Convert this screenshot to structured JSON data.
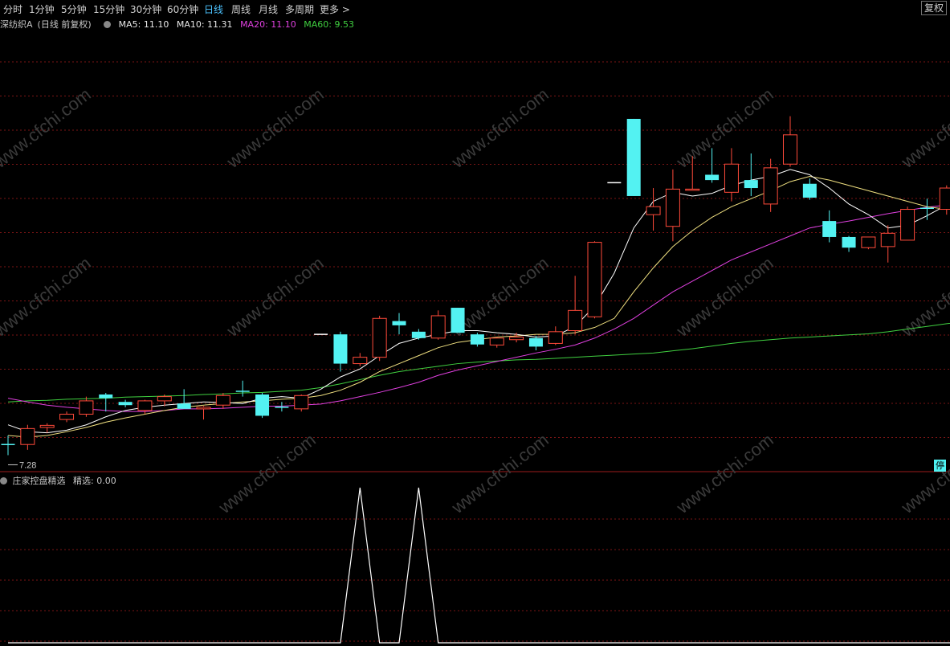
{
  "toolbar": {
    "tabs": [
      "分时",
      "1分钟",
      "5分钟",
      "15分钟",
      "30分钟",
      "60分钟",
      "日线",
      "周线",
      "月线",
      "多周期",
      "更多 >"
    ],
    "active_tab": "日线",
    "adjust_button": "复权"
  },
  "info": {
    "stock": "深纺织A",
    "period": "(日线 前复权)",
    "ma5": "MA5: 11.10",
    "ma10": "MA10: 11.31",
    "ma20": "MA20: 11.10",
    "ma60": "MA60: 9.53"
  },
  "indicator": {
    "name": "庄家控盘精选",
    "value": "精选: 0.00"
  },
  "low_marker": "7.28",
  "stop_badge": "停",
  "watermark": "www.cfchi.com",
  "colors": {
    "up": "#ff4a3a",
    "down": "#53f2f2",
    "ma5": "#ffffff",
    "ma10": "#f0e080",
    "ma20": "#e040e0",
    "ma60": "#40d040",
    "grid": "#7a1515",
    "indicator_line": "#ffffff"
  },
  "chart_data": [
    {
      "type": "candlestick",
      "price_range": [
        7.0,
        15.2
      ],
      "low_label": 7.28,
      "candles": [
        {
          "o": 7.48,
          "h": 7.65,
          "l": 7.28,
          "c": 7.48,
          "dir": "flat"
        },
        {
          "o": 7.48,
          "h": 7.85,
          "l": 7.38,
          "c": 7.78,
          "dir": "up"
        },
        {
          "o": 7.8,
          "h": 7.88,
          "l": 7.7,
          "c": 7.84,
          "dir": "up"
        },
        {
          "o": 7.95,
          "h": 8.1,
          "l": 7.9,
          "c": 8.05,
          "dir": "up"
        },
        {
          "o": 8.05,
          "h": 8.38,
          "l": 8.0,
          "c": 8.3,
          "dir": "up"
        },
        {
          "o": 8.42,
          "h": 8.45,
          "l": 8.1,
          "c": 8.35,
          "dir": "down"
        },
        {
          "o": 8.28,
          "h": 8.32,
          "l": 8.18,
          "c": 8.22,
          "dir": "down"
        },
        {
          "o": 8.12,
          "h": 8.32,
          "l": 8.05,
          "c": 8.3,
          "dir": "up"
        },
        {
          "o": 8.3,
          "h": 8.42,
          "l": 8.2,
          "c": 8.38,
          "dir": "up"
        },
        {
          "o": 8.25,
          "h": 8.52,
          "l": 8.18,
          "c": 8.15,
          "dir": "down"
        },
        {
          "o": 8.15,
          "h": 8.2,
          "l": 7.95,
          "c": 8.18,
          "dir": "up"
        },
        {
          "o": 8.22,
          "h": 8.45,
          "l": 8.15,
          "c": 8.4,
          "dir": "up"
        },
        {
          "o": 8.48,
          "h": 8.68,
          "l": 8.38,
          "c": 8.48,
          "dir": "flat"
        },
        {
          "o": 8.42,
          "h": 8.45,
          "l": 7.98,
          "c": 8.02,
          "dir": "down"
        },
        {
          "o": 8.18,
          "h": 8.28,
          "l": 8.1,
          "c": 8.18,
          "dir": "flat"
        },
        {
          "o": 8.15,
          "h": 8.42,
          "l": 8.1,
          "c": 8.4,
          "dir": "up"
        },
        {
          "o": 9.55,
          "h": 9.55,
          "l": 9.55,
          "c": 9.55,
          "dir": "flat"
        },
        {
          "o": 9.55,
          "h": 9.6,
          "l": 8.85,
          "c": 9.0,
          "dir": "down"
        },
        {
          "o": 9.0,
          "h": 9.2,
          "l": 8.95,
          "c": 9.12,
          "dir": "up"
        },
        {
          "o": 9.12,
          "h": 9.9,
          "l": 9.05,
          "c": 9.85,
          "dir": "up"
        },
        {
          "o": 9.8,
          "h": 9.95,
          "l": 9.55,
          "c": 9.72,
          "dir": "down"
        },
        {
          "o": 9.6,
          "h": 9.65,
          "l": 9.45,
          "c": 9.48,
          "dir": "down"
        },
        {
          "o": 9.48,
          "h": 10.0,
          "l": 9.45,
          "c": 9.9,
          "dir": "up"
        },
        {
          "o": 10.05,
          "h": 10.05,
          "l": 9.58,
          "c": 9.58,
          "dir": "down"
        },
        {
          "o": 9.55,
          "h": 9.58,
          "l": 9.32,
          "c": 9.36,
          "dir": "down"
        },
        {
          "o": 9.35,
          "h": 9.5,
          "l": 9.3,
          "c": 9.48,
          "dir": "up"
        },
        {
          "o": 9.45,
          "h": 9.58,
          "l": 9.4,
          "c": 9.5,
          "dir": "up"
        },
        {
          "o": 9.48,
          "h": 9.52,
          "l": 9.25,
          "c": 9.32,
          "dir": "down"
        },
        {
          "o": 9.38,
          "h": 9.7,
          "l": 9.35,
          "c": 9.6,
          "dir": "up"
        },
        {
          "o": 9.62,
          "h": 10.65,
          "l": 9.55,
          "c": 10.0,
          "dir": "up"
        },
        {
          "o": 9.88,
          "h": 11.3,
          "l": 9.85,
          "c": 11.28,
          "dir": "up"
        },
        {
          "o": 12.4,
          "h": 12.4,
          "l": 12.4,
          "c": 12.4,
          "dir": "flat"
        },
        {
          "o": 13.6,
          "h": 13.6,
          "l": 12.15,
          "c": 12.15,
          "dir": "down"
        },
        {
          "o": 11.8,
          "h": 12.3,
          "l": 11.5,
          "c": 11.95,
          "dir": "up"
        },
        {
          "o": 11.58,
          "h": 12.65,
          "l": 11.3,
          "c": 12.28,
          "dir": "up"
        },
        {
          "o": 12.28,
          "h": 12.9,
          "l": 12.28,
          "c": 12.28,
          "dir": "up"
        },
        {
          "o": 12.55,
          "h": 13.05,
          "l": 12.4,
          "c": 12.45,
          "dir": "down"
        },
        {
          "o": 12.22,
          "h": 13.05,
          "l": 12.05,
          "c": 12.75,
          "dir": "up"
        },
        {
          "o": 12.45,
          "h": 12.95,
          "l": 12.15,
          "c": 12.3,
          "dir": "down"
        },
        {
          "o": 12.0,
          "h": 12.85,
          "l": 11.85,
          "c": 12.68,
          "dir": "up"
        },
        {
          "o": 12.75,
          "h": 13.65,
          "l": 12.7,
          "c": 13.3,
          "dir": "up"
        },
        {
          "o": 12.38,
          "h": 12.48,
          "l": 12.08,
          "c": 12.12,
          "dir": "down"
        },
        {
          "o": 11.68,
          "h": 11.88,
          "l": 11.28,
          "c": 11.38,
          "dir": "down"
        },
        {
          "o": 11.38,
          "h": 11.4,
          "l": 11.1,
          "c": 11.18,
          "dir": "down"
        },
        {
          "o": 11.18,
          "h": 11.38,
          "l": 11.15,
          "c": 11.38,
          "dir": "up"
        },
        {
          "o": 11.2,
          "h": 11.6,
          "l": 10.9,
          "c": 11.45,
          "dir": "up"
        },
        {
          "o": 11.32,
          "h": 11.95,
          "l": 11.32,
          "c": 11.9,
          "dir": "up"
        },
        {
          "o": 11.92,
          "h": 12.1,
          "l": 11.7,
          "c": 11.92,
          "dir": "flat"
        },
        {
          "o": 11.9,
          "h": 12.35,
          "l": 11.8,
          "c": 12.3,
          "dir": "up"
        },
        {
          "o": 12.25,
          "h": 12.45,
          "l": 11.95,
          "c": 12.08,
          "dir": "down"
        }
      ],
      "ma5": [
        7.85,
        7.72,
        7.7,
        7.75,
        7.85,
        8.0,
        8.12,
        8.18,
        8.22,
        8.25,
        8.28,
        8.27,
        8.25,
        8.35,
        8.38,
        8.35,
        8.52,
        8.75,
        8.9,
        9.15,
        9.38,
        9.48,
        9.55,
        9.62,
        9.62,
        9.58,
        9.55,
        9.5,
        9.52,
        9.7,
        10.08,
        10.7,
        11.55,
        12.05,
        12.22,
        12.15,
        12.2,
        12.35,
        12.45,
        12.52,
        12.65,
        12.55,
        12.3,
        12.0,
        11.8,
        11.55,
        11.6,
        11.78,
        11.98,
        12.05
      ],
      "ma10": [
        7.65,
        7.62,
        7.65,
        7.72,
        7.8,
        7.9,
        7.98,
        8.05,
        8.12,
        8.18,
        8.22,
        8.25,
        8.28,
        8.3,
        8.33,
        8.35,
        8.4,
        8.5,
        8.65,
        8.85,
        9.0,
        9.15,
        9.3,
        9.4,
        9.45,
        9.5,
        9.52,
        9.55,
        9.55,
        9.58,
        9.68,
        9.85,
        10.35,
        10.8,
        11.2,
        11.5,
        11.75,
        11.95,
        12.1,
        12.25,
        12.42,
        12.52,
        12.45,
        12.35,
        12.25,
        12.15,
        12.05,
        11.95,
        11.9,
        11.92
      ],
      "ma20": [
        8.35,
        8.28,
        8.22,
        8.18,
        8.15,
        8.12,
        8.1,
        8.1,
        8.12,
        8.15,
        8.15,
        8.16,
        8.18,
        8.2,
        8.2,
        8.22,
        8.24,
        8.3,
        8.38,
        8.46,
        8.55,
        8.65,
        8.78,
        8.88,
        8.96,
        9.04,
        9.12,
        9.2,
        9.27,
        9.35,
        9.48,
        9.65,
        9.85,
        10.1,
        10.35,
        10.55,
        10.75,
        10.95,
        11.1,
        11.25,
        11.4,
        11.55,
        11.62,
        11.68,
        11.75,
        11.82,
        11.88,
        11.94,
        11.98,
        12.02
      ],
      "ma60": [
        8.28,
        8.3,
        8.31,
        8.33,
        8.34,
        8.35,
        8.37,
        8.38,
        8.39,
        8.4,
        8.42,
        8.43,
        8.45,
        8.46,
        8.48,
        8.5,
        8.55,
        8.62,
        8.7,
        8.78,
        8.85,
        8.9,
        8.95,
        9.0,
        9.03,
        9.05,
        9.07,
        9.08,
        9.1,
        9.12,
        9.14,
        9.16,
        9.18,
        9.2,
        9.24,
        9.28,
        9.33,
        9.38,
        9.42,
        9.45,
        9.48,
        9.5,
        9.52,
        9.54,
        9.56,
        9.6,
        9.65,
        9.7,
        9.75,
        9.8
      ]
    },
    {
      "type": "line",
      "title": "庄家控盘精选",
      "series": [
        {
          "name": "精选",
          "values": [
            0,
            0,
            0,
            0,
            0,
            0,
            0,
            0,
            0,
            0,
            0,
            0,
            0,
            0,
            0,
            0,
            0,
            0,
            1,
            0,
            0,
            1,
            0,
            0,
            0,
            0,
            0,
            0,
            0,
            0,
            0,
            0,
            0,
            0,
            0,
            0,
            0,
            0,
            0,
            0,
            0,
            0,
            0,
            0,
            0,
            0,
            0,
            0,
            0,
            0
          ]
        }
      ]
    }
  ]
}
